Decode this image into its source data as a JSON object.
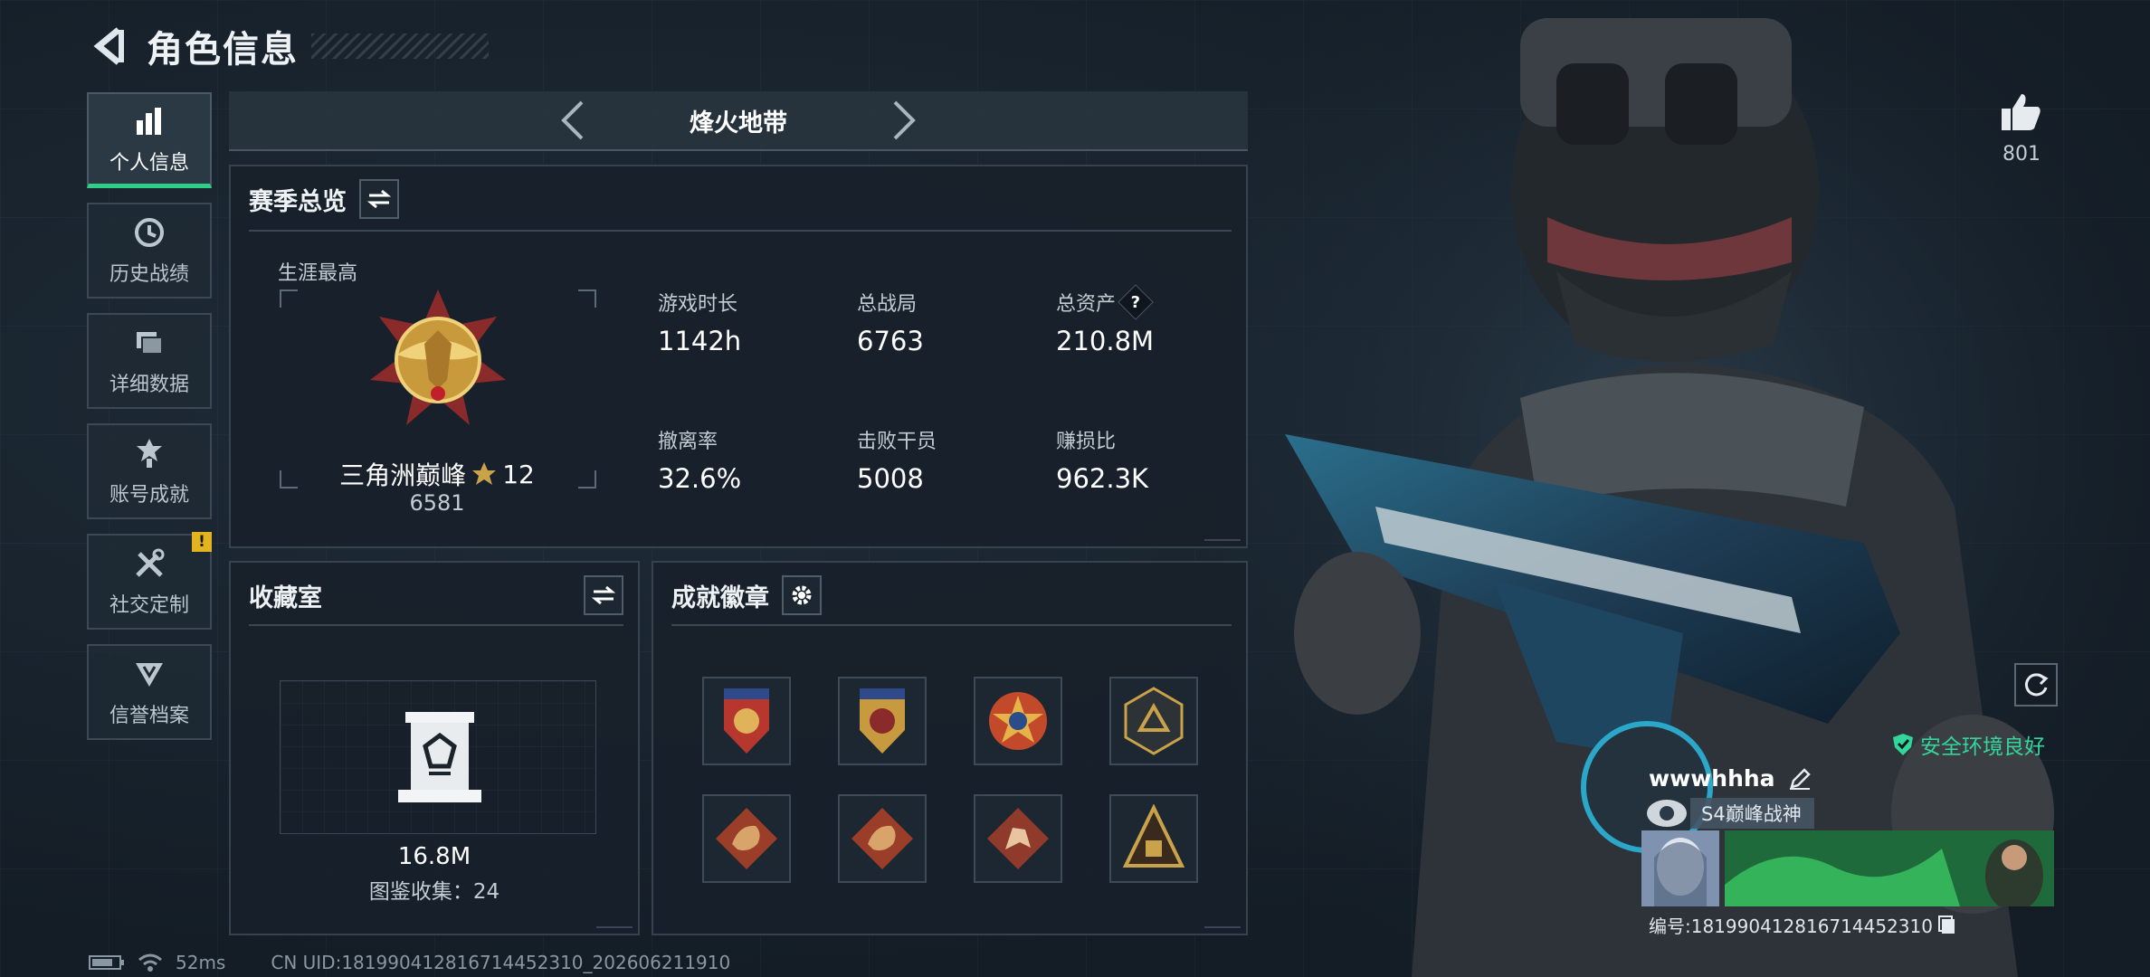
{
  "header": {
    "title": "角色信息"
  },
  "nav": {
    "items": [
      {
        "label": "个人信息",
        "active": true,
        "icon": "bar-chart-icon"
      },
      {
        "label": "历史战绩",
        "active": false,
        "icon": "history-icon"
      },
      {
        "label": "详细数据",
        "active": false,
        "icon": "folder-icon"
      },
      {
        "label": "账号成就",
        "active": false,
        "icon": "achievement-icon"
      },
      {
        "label": "社交定制",
        "active": false,
        "icon": "tools-icon",
        "badge": "!"
      },
      {
        "label": "信誉档案",
        "active": false,
        "icon": "credit-icon"
      }
    ]
  },
  "mode": {
    "label": "烽火地带"
  },
  "season": {
    "title": "赛季总览",
    "career_label": "生涯最高",
    "rank_name": "三角洲巅峰",
    "rank_stars": "12",
    "rank_points": "6581",
    "stats": [
      {
        "label": "游戏时长",
        "value": "1142h"
      },
      {
        "label": "总战局",
        "value": "6763"
      },
      {
        "label": "总资产",
        "value": "210.8M",
        "help": "?"
      },
      {
        "label": "撤离率",
        "value": "32.6%"
      },
      {
        "label": "击败干员",
        "value": "5008"
      },
      {
        "label": "赚损比",
        "value": "962.3K"
      }
    ]
  },
  "collection": {
    "title": "收藏室",
    "value": "16.8M",
    "count_text": "图鉴收集：24"
  },
  "badges": {
    "title": "成就徽章",
    "colors": {
      "bronze": "#b9572f",
      "gold": "#c9a24a",
      "dark": "#2a2f35"
    }
  },
  "profile": {
    "likes": "801",
    "safety_text": "安全环境良好",
    "player_name": "wwwhhha",
    "player_title": "S4巅峰战神",
    "uid_text": "编号:181990412816714452310"
  },
  "footer": {
    "ping": "52ms",
    "uid": "CN UID:181990412816714452310_202606211910"
  },
  "colors": {
    "accent": "#2fcf8a",
    "warn": "#e3b320",
    "safe": "#33d69a"
  }
}
